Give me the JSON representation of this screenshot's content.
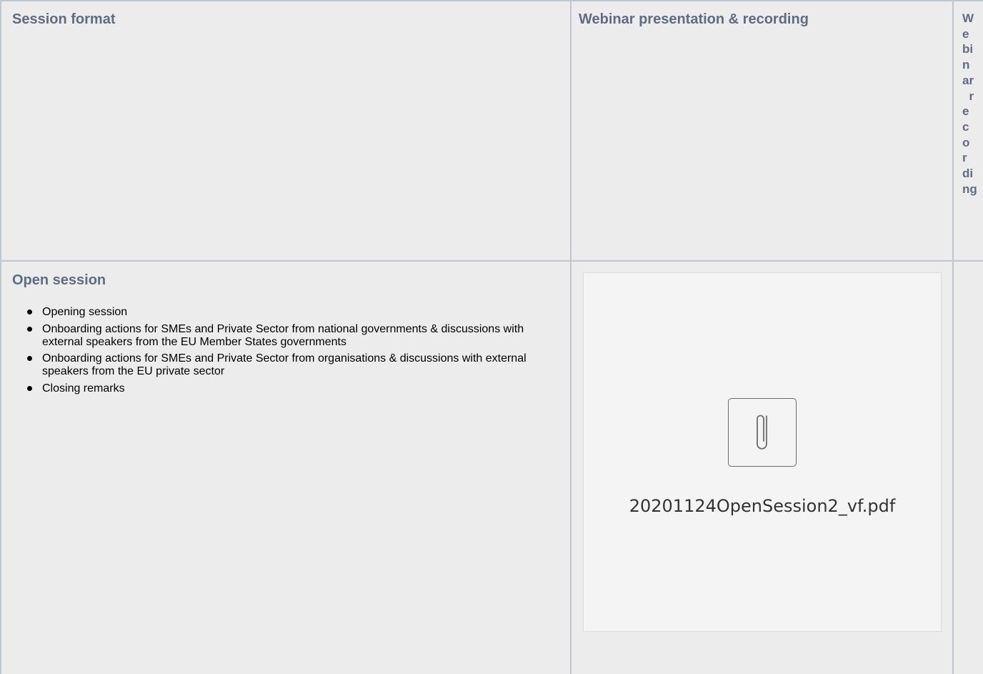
{
  "table": {
    "headers": {
      "session_format": "Session format",
      "presentation": "Webinar presentation & recording",
      "recording_lines": [
        "W",
        "e",
        "bi",
        "n",
        "ar",
        "  r",
        "e",
        "c",
        "o",
        "r",
        "di",
        "ng"
      ]
    },
    "row": {
      "title": "Open session",
      "items": [
        "Opening session",
        "Onboarding actions for SMEs and Private Sector from national governments & discussions with external speakers from the EU Member States governments",
        "Onboarding actions for SMEs and Private Sector from organisations & discussions with external speakers from the EU private sector",
        "Closing remarks"
      ],
      "attachment": {
        "icon": "paperclip-icon",
        "file_name": "20201124OpenSession2_vf.pdf"
      }
    }
  },
  "colors": {
    "header_text": "#5e6c84",
    "cell_background": "#ececec",
    "border": "#c1c7d0"
  }
}
